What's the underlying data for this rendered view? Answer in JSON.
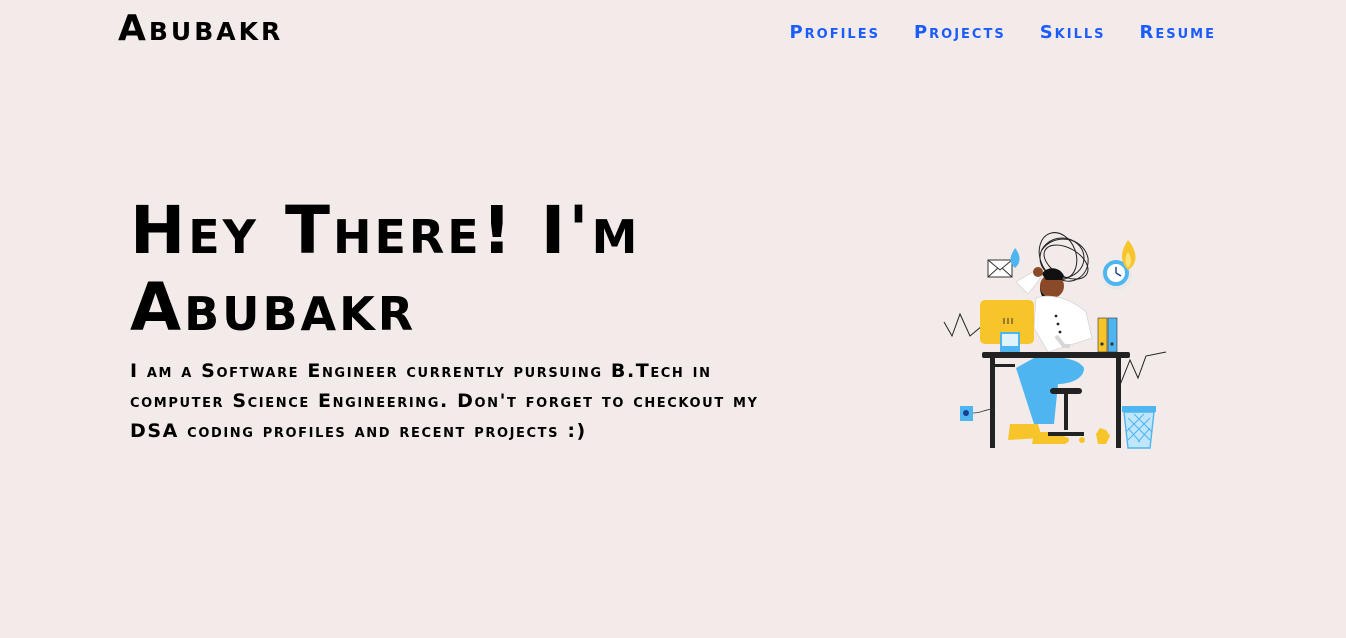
{
  "header": {
    "brand": "Abubakr",
    "nav": [
      {
        "label": "Profiles"
      },
      {
        "label": "Projects"
      },
      {
        "label": "Skills"
      },
      {
        "label": "Resume"
      }
    ]
  },
  "hero": {
    "title": "Hey There! I'm Abubakr",
    "description": "I am a Software Engineer currently pursuing B.Tech in computer Science Engineering. Don't forget to checkout my DSA coding profiles and recent projects :)"
  },
  "colors": {
    "background": "#f3ebe9",
    "nav_link": "#1a5cff",
    "text": "#000000"
  },
  "illustration": {
    "icon": "stressed-developer-at-desk-illustration"
  }
}
